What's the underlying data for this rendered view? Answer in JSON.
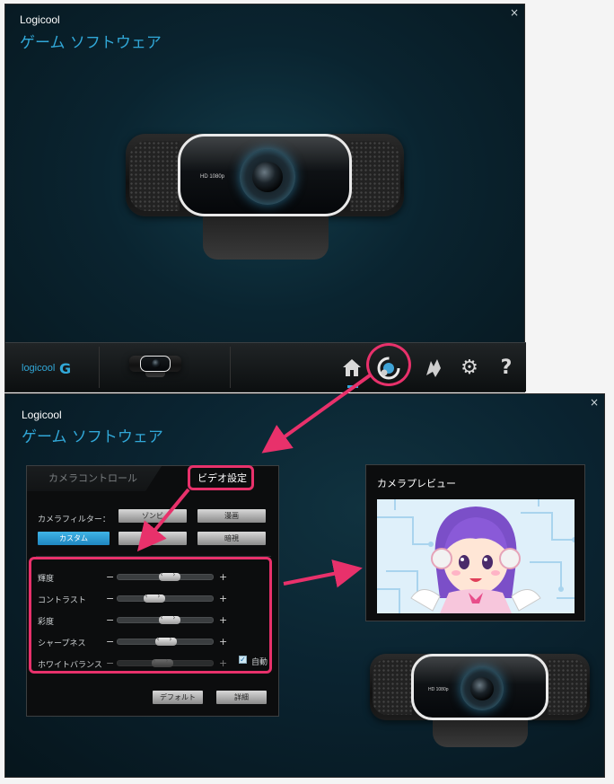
{
  "window1": {
    "close_glyph": "×",
    "brand": "Logicool",
    "title": "ゲーム ソフトウェア",
    "webcam": {
      "model_label": "HD 1080p"
    },
    "taskbar": {
      "logo_text": "logicool",
      "logo_mark": "G",
      "icons": [
        "home-icon",
        "camera-settings-icon",
        "customize-icon",
        "gear-icon",
        "help-icon"
      ],
      "help_glyph": "?",
      "settings_glyph": "⚙",
      "home_glyph": "⌂"
    }
  },
  "window2": {
    "close_glyph": "×",
    "brand": "Logicool",
    "title": "ゲーム ソフトウェア",
    "panel": {
      "tabs": [
        {
          "label": "カメラコントロール",
          "active": false
        },
        {
          "label": "ビデオ設定",
          "active": true
        }
      ],
      "filter_label": "カメラフィルター：",
      "filters_row1": [
        "ゾンビ",
        "漫画"
      ],
      "filters_row2": [
        "カスタム",
        "",
        "暗視"
      ],
      "selected_filter": "カスタム",
      "sliders": [
        {
          "label": "輝度",
          "value": 0.55,
          "enabled": true
        },
        {
          "label": "コントラスト",
          "value": 0.35,
          "enabled": true
        },
        {
          "label": "彩度",
          "value": 0.55,
          "enabled": true
        },
        {
          "label": "シャープネス",
          "value": 0.5,
          "enabled": true
        },
        {
          "label": "ホワイトバランス",
          "value": 0.45,
          "enabled": false
        }
      ],
      "minus_glyph": "−",
      "plus_glyph": "+",
      "auto_label": "自動",
      "auto_checked": true,
      "check_glyph": "✓",
      "default_button": "デフォルト",
      "details_button": "詳細"
    },
    "preview": {
      "title": "カメラプレビュー"
    },
    "webcam": {
      "model_label": "HD 1080p"
    }
  },
  "colors": {
    "accent": "#31a8d8",
    "highlight": "#e8316b"
  }
}
